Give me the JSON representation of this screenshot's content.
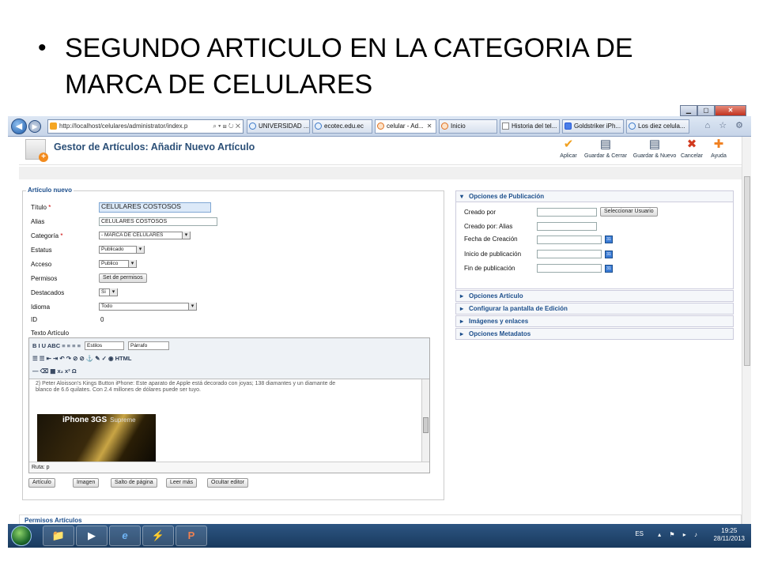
{
  "slide": {
    "bullet": "•",
    "title": "SEGUNDO ARTICULO EN LA CATEGORIA DE MARCA DE CELULARES"
  },
  "browser": {
    "window_min": "▁",
    "window_max": "▢",
    "window_close": "✕",
    "back_glyph": "◀",
    "fwd_glyph": "▶",
    "address": "http://localhost/celulares/administrator/index.p",
    "address_tools": "⌕ ▾ ⊞ ↻ ✕",
    "tabs": [
      {
        "label": "UNIVERSIDAD ...",
        "active": false
      },
      {
        "label": "ecotec.edu.ec",
        "active": false
      },
      {
        "label": "celular - Ad...",
        "active": true,
        "close": "✕"
      },
      {
        "label": "Inicio",
        "active": false
      },
      {
        "label": "Historia del tel...",
        "active": false
      },
      {
        "label": "Goldstriker iPh...",
        "active": false
      },
      {
        "label": "Los diez celula...",
        "active": false
      }
    ],
    "right_tools": "⌂ ☆ ⚙"
  },
  "header": {
    "title": "Gestor de Artículos: Añadir Nuevo Artículo",
    "buttons": [
      {
        "label": "Aplicar",
        "glyph": "✔",
        "color": "#f0a020"
      },
      {
        "label": "Guardar & Cerrar",
        "glyph": "▤",
        "color": "#3a4f6c"
      },
      {
        "label": "Guardar & Nuevo",
        "glyph": "▤",
        "color": "#3a4f6c"
      },
      {
        "label": "Cancelar",
        "glyph": "✖",
        "color": "#d23a1e"
      },
      {
        "label": "Ayuda",
        "glyph": "✚",
        "color": "#f08020"
      }
    ]
  },
  "form": {
    "legend": "Artículo nuevo",
    "required_mark": "*",
    "titulo_label": "Título",
    "titulo_value": "CELULARES COSTOSOS",
    "alias_label": "Alias",
    "alias_value": "CELULARES COSTOSOS",
    "categoria_label": "Categoría",
    "categoria_value": "- MARCA DE CELULARES",
    "estatus_label": "Estatus",
    "estatus_value": "Publicado",
    "acceso_label": "Acceso",
    "acceso_value": "Publico",
    "permisos_label": "Permisos",
    "permisos_button": "Set de permisos",
    "destacados_label": "Destacados",
    "destacados_value": "Si",
    "idioma_label": "Idioma",
    "idioma_value": "Todo",
    "id_label": "ID",
    "id_value": "0",
    "texto_label": "Texto Artículo"
  },
  "editor": {
    "estilos": "Estilos",
    "parrafo": "Párrafo",
    "row1_icons": "B  I  U  ABC  ≡  ≡  ≡  ≡",
    "row2_icons": "☰  ☰  ⇤  ⇥  ↶  ↷  ⊘  ⊘  ⚓  ✎  ✓  ◉  HTML",
    "row3_icons": "—  ⌫  ▦  x₂  x²  Ω",
    "content_line1": "2) Peter Aloisson's Kings Button iPhone: Este aparato de Apple está decorado con joyas; 138 diamantes y un diamante de",
    "content_line2": "blanco de 6.6 quilates. Con 2.4 millones de dólares puede ser tuyo.",
    "image_text": "iPhone 3G",
    "image_suffix": "S",
    "image_sub": "Supreme",
    "path_label": "Ruta: p",
    "buttons": [
      "Artículo",
      "Imagen",
      "Salto de página",
      "Leer más",
      "Ocultar editor"
    ]
  },
  "publicacion": {
    "heading": "Opciones de Publicación",
    "creado_por": "Creado por",
    "select_user": "Seleccionar Usuario",
    "creado_alias": "Creado por: Alias",
    "fecha_creacion": "Fecha de Creación",
    "inicio_pub": "Inicio de publicación",
    "fin_pub": "Fin de publicación",
    "cal_glyph": "31"
  },
  "accordions": [
    "Opciones Artículo",
    "Configurar la pantalla de Edición",
    "Imágenes y enlaces",
    "Opciones Metadatos"
  ],
  "permisos_section": "Permisos Artículos",
  "taskbar": {
    "apps": [
      "📁",
      "▶",
      "e",
      "⚡",
      "P"
    ],
    "lang": "ES",
    "tray_icons": "▴ ⚑ ▸ ♪",
    "time": "19:25",
    "date": "28/11/2013"
  }
}
